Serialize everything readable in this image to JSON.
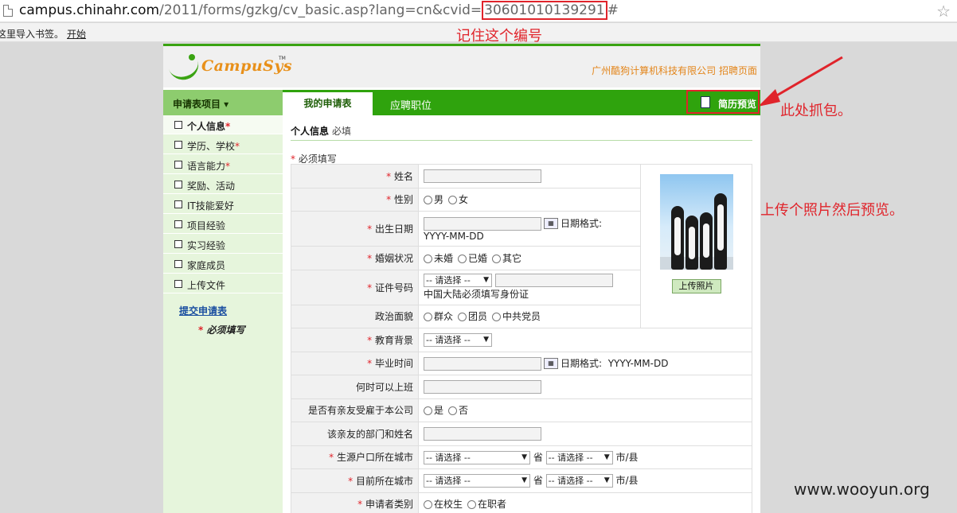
{
  "browser": {
    "url_host": "campus.chinahr.com",
    "url_path": "/2011/forms/gzkg/cv_basic.asp?lang=cn&cvid=",
    "url_cvid": "30601010139291",
    "url_hash": "#",
    "bookmark_hint": "这里导入书签。",
    "bookmark_start": "开始"
  },
  "annotations": {
    "remember_id": "记住这个编号",
    "capture_here": "此处抓包。",
    "upload_preview": "上传个照片然后预览。",
    "watermark": "www.wooyun.org"
  },
  "header": {
    "logo_text": "CampuSys",
    "logo_tm": "TM",
    "company": "广州酷狗计算机科技有限公司 招聘页面"
  },
  "nav": {
    "menu_label": "申请表项目 ▾",
    "tab_active": "我的申请表",
    "tab_positions": "应聘职位",
    "resume_preview": "简历预览"
  },
  "sidebar": {
    "items": [
      {
        "label": "个人信息",
        "required": "*"
      },
      {
        "label": "学历、学校",
        "required": "*"
      },
      {
        "label": "语言能力",
        "required": "*"
      },
      {
        "label": "奖励、活动",
        "required": ""
      },
      {
        "label": "IT技能爱好",
        "required": ""
      },
      {
        "label": "项目经验",
        "required": ""
      },
      {
        "label": "实习经验",
        "required": ""
      },
      {
        "label": "家庭成员",
        "required": ""
      },
      {
        "label": "上传文件",
        "required": ""
      }
    ],
    "submit": "提交申请表",
    "must_fill": "必须填写",
    "must_star": "*"
  },
  "section": {
    "title": "个人信息",
    "subtitle": "必填",
    "must_note": "必须填写"
  },
  "form": {
    "name": "姓名",
    "gender": "性别",
    "gender_male": "男",
    "gender_female": "女",
    "birth": "出生日期",
    "date_format_label": "日期格式:",
    "date_format": "YYYY-MM-DD",
    "marital": "婚姻状况",
    "marital_single": "未婚",
    "marital_married": "已婚",
    "marital_other": "其它",
    "id_number": "证件号码",
    "select_placeholder": "-- 请选择 --",
    "id_note": "中国大陆必须填写身份证",
    "political": "政治面貌",
    "political_1": "群众",
    "political_2": "团员",
    "political_3": "中共党员",
    "education": "教育背景",
    "graduation": "毕业时间",
    "available": "何时可以上班",
    "relatives": "是否有亲友受雇于本公司",
    "yes": "是",
    "no": "否",
    "relative_dept": "该亲友的部门和姓名",
    "hukou_city": "生源户口所在城市",
    "current_city": "目前所在城市",
    "province": "省",
    "city_county": "市/县",
    "applicant_type": "申请者类别",
    "student": "在校生",
    "employed": "在职者",
    "upload_photo": "上传照片"
  }
}
